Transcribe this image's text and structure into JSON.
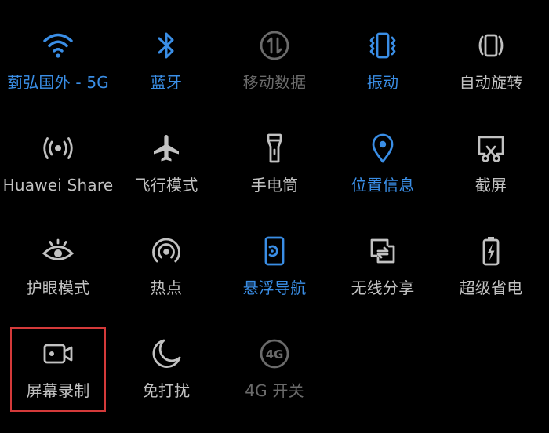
{
  "tiles": [
    {
      "label": "菿弘国外 - 5G",
      "icon": "wifi-icon",
      "state": "on"
    },
    {
      "label": "蓝牙",
      "icon": "bluetooth-icon",
      "state": "on"
    },
    {
      "label": "移动数据",
      "icon": "mobile-data-icon",
      "state": "disabled"
    },
    {
      "label": "振动",
      "icon": "vibrate-icon",
      "state": "on"
    },
    {
      "label": "自动旋转",
      "icon": "auto-rotate-icon",
      "state": "off"
    },
    {
      "label": "Huawei Share",
      "icon": "huawei-share-icon",
      "state": "off"
    },
    {
      "label": "飞行模式",
      "icon": "airplane-icon",
      "state": "off"
    },
    {
      "label": "手电筒",
      "icon": "flashlight-icon",
      "state": "off"
    },
    {
      "label": "位置信息",
      "icon": "location-icon",
      "state": "on"
    },
    {
      "label": "截屏",
      "icon": "screenshot-icon",
      "state": "off"
    },
    {
      "label": "护眼模式",
      "icon": "eye-comfort-icon",
      "state": "off"
    },
    {
      "label": "热点",
      "icon": "hotspot-icon",
      "state": "off"
    },
    {
      "label": "悬浮导航",
      "icon": "floating-nav-icon",
      "state": "on"
    },
    {
      "label": "无线分享",
      "icon": "wireless-share-icon",
      "state": "off"
    },
    {
      "label": "超级省电",
      "icon": "battery-saver-icon",
      "state": "off"
    },
    {
      "label": "屏幕录制",
      "icon": "screen-record-icon",
      "state": "off"
    },
    {
      "label": "免打扰",
      "icon": "moon-icon",
      "state": "off"
    },
    {
      "label": "4G 开关",
      "icon": "4g-icon",
      "state": "disabled"
    }
  ],
  "colors": {
    "active": "#3a8ee6",
    "inactive": "#c2c2c2",
    "disabled": "#6b6b6b",
    "highlight": "#d43a3a",
    "background": "#000000"
  }
}
